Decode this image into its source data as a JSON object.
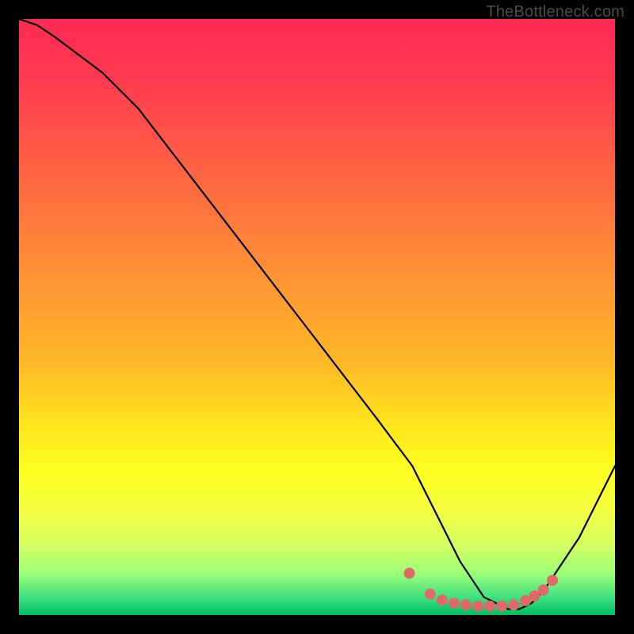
{
  "signature": "TheBottleneck.com",
  "chart_data": {
    "type": "line",
    "title": "",
    "xlabel": "",
    "ylabel": "",
    "xlim": [
      0,
      100
    ],
    "ylim": [
      0,
      100
    ],
    "grid": false,
    "legend": false,
    "series": [
      {
        "name": "curve",
        "color": "#000000",
        "x": [
          0,
          3,
          6,
          14,
          20,
          30,
          40,
          50,
          60,
          66,
          70,
          74,
          78,
          82,
          84,
          86,
          88,
          94,
          100
        ],
        "values": [
          100,
          99,
          97,
          91,
          85,
          72,
          59,
          46,
          33,
          25,
          17,
          9,
          3,
          1,
          1,
          2,
          4,
          13,
          25
        ]
      }
    ],
    "markers": {
      "name": "highlight-dots",
      "color": "#e06a6a",
      "radius": 7,
      "x": [
        65.5,
        69.0,
        71.0,
        73.0,
        75.0,
        77.0,
        79.0,
        81.0,
        83.0,
        85.0,
        86.5,
        88.0,
        89.5
      ],
      "values": [
        7.0,
        3.5,
        2.5,
        2.0,
        1.7,
        1.5,
        1.5,
        1.5,
        1.7,
        2.4,
        3.2,
        4.2,
        5.8
      ]
    },
    "background": {
      "type": "vertical-gradient",
      "stops": [
        {
          "pos": 0.0,
          "color": "#ff2a55"
        },
        {
          "pos": 0.1,
          "color": "#ff3a50"
        },
        {
          "pos": 0.22,
          "color": "#ff5a46"
        },
        {
          "pos": 0.34,
          "color": "#ff7a3c"
        },
        {
          "pos": 0.46,
          "color": "#ff9a32"
        },
        {
          "pos": 0.58,
          "color": "#ffba28"
        },
        {
          "pos": 0.68,
          "color": "#ffe41e"
        },
        {
          "pos": 0.76,
          "color": "#ffff22"
        },
        {
          "pos": 0.82,
          "color": "#f4ff40"
        },
        {
          "pos": 0.88,
          "color": "#d8ff60"
        },
        {
          "pos": 0.93,
          "color": "#9cff78"
        },
        {
          "pos": 0.97,
          "color": "#40e080"
        },
        {
          "pos": 1.0,
          "color": "#00c060"
        }
      ]
    }
  }
}
